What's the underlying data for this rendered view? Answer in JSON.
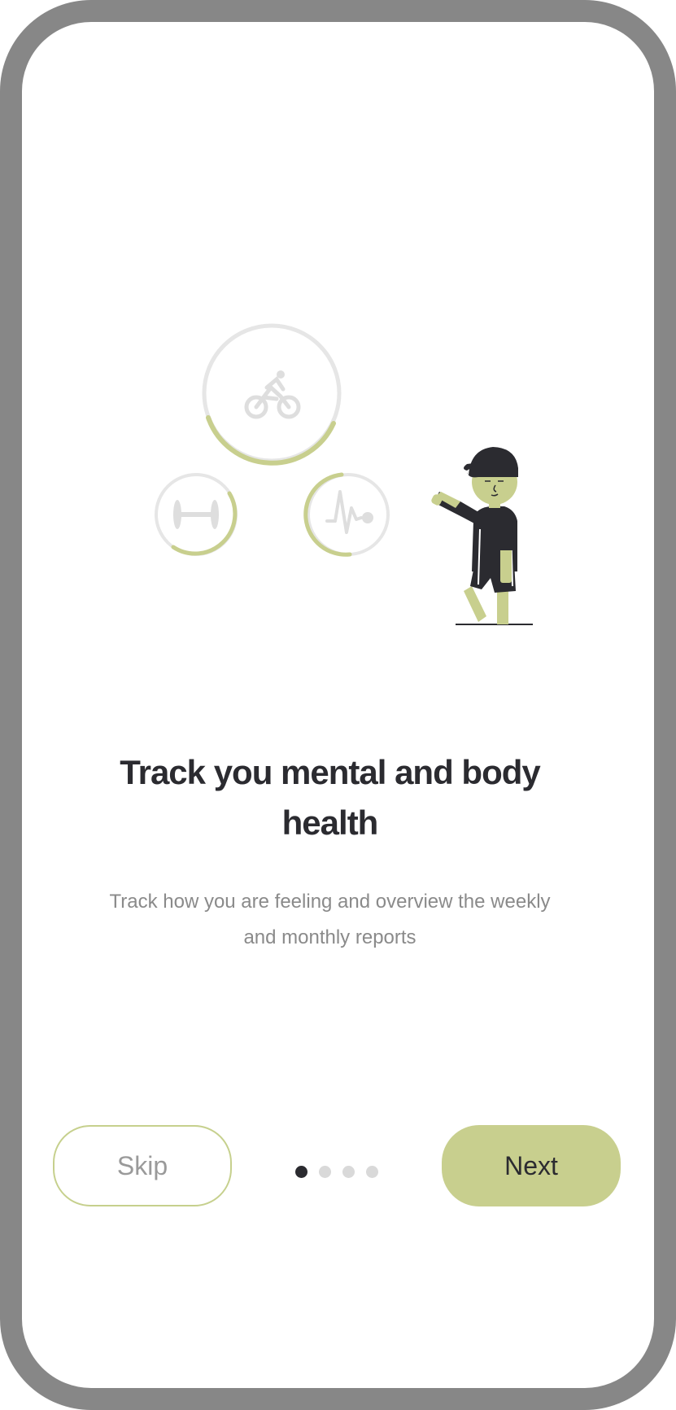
{
  "onboarding": {
    "title": "Track you mental and body health",
    "subtitle": "Track how you are feeling and overview the weekly and monthly reports",
    "skip_label": "Skip",
    "next_label": "Next",
    "page_indicator": {
      "total": 4,
      "current": 1
    }
  },
  "icons": {
    "activities": [
      "bicycle-icon",
      "dumbbell-icon",
      "heartbeat-icon"
    ],
    "character": "person-waving-illustration"
  },
  "colors": {
    "accent": "#c8cf8e",
    "text_dark": "#2b2b30",
    "text_muted": "#8a8a8a",
    "ring_track": "#e6e6e6",
    "frame": "#878787"
  }
}
